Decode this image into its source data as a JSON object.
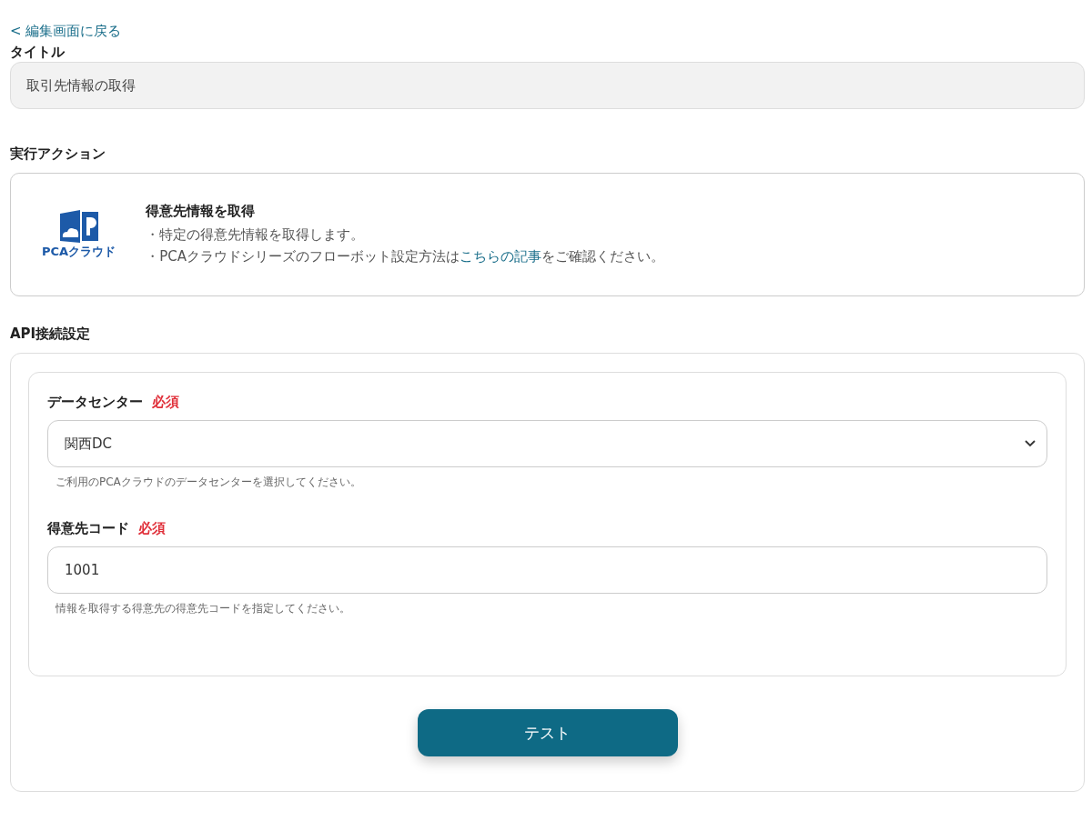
{
  "back_link": "< 編集画面に戻る",
  "title_section": {
    "label": "タイトル",
    "value": "取引先情報の取得"
  },
  "action_section": {
    "label": "実行アクション",
    "logo_text": "PCAクラウド",
    "action_title": "得意先情報を取得",
    "lines": [
      {
        "before": "・特定の得意先情報を取得します。"
      },
      {
        "before": "・PCAクラウドシリーズのフローボット設定方法は",
        "link": "こちらの記事",
        "after": "をご確認ください。"
      }
    ]
  },
  "api_section": {
    "label": "API接続設定",
    "fields": [
      {
        "kind": "select",
        "label": "データセンター",
        "required": "必須",
        "value": "関西DC",
        "help": "ご利用のPCAクラウドのデータセンターを選択してください。"
      },
      {
        "kind": "text",
        "label": "得意先コード",
        "required": "必須",
        "value": "1001",
        "help": "情報を取得する得意先の得意先コードを指定してください。"
      }
    ],
    "button": "テスト"
  }
}
